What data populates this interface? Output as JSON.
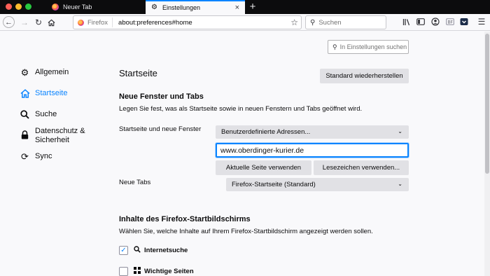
{
  "tabs": [
    {
      "title": "Neuer Tab",
      "favicon": "firefox-icon"
    },
    {
      "title": "Einstellungen",
      "favicon": "gear-icon",
      "active": true
    }
  ],
  "navbar": {
    "identity_label": "Firefox",
    "url": "about:preferences#home",
    "search_placeholder": "Suchen"
  },
  "sidebar": {
    "items": [
      {
        "label": "Allgemein",
        "icon": "gear-icon"
      },
      {
        "label": "Startseite",
        "icon": "home-icon",
        "active": true
      },
      {
        "label": "Suche",
        "icon": "search-icon"
      },
      {
        "label": "Datenschutz &",
        "label2": "Sicherheit",
        "icon": "lock-icon"
      },
      {
        "label": "Sync",
        "icon": "sync-icon"
      }
    ]
  },
  "prefs_search_placeholder": "In Einstellungen suchen",
  "main": {
    "title": "Startseite",
    "restore_button": "Standard wiederherstellen",
    "section1": {
      "title": "Neue Fenster und Tabs",
      "description": "Legen Sie fest, was als Startseite sowie in neuen Fenstern und Tabs geöffnet wird.",
      "homepage_label": "Startseite und neue Fenster",
      "homepage_select": "Benutzerdefinierte Adressen...",
      "homepage_url": "www.oberdinger-kurier.de",
      "use_current_button": "Aktuelle Seite verwenden",
      "use_bookmark_button": "Lesezeichen verwenden...",
      "newtabs_label": "Neue Tabs",
      "newtabs_select": "Firefox-Startseite (Standard)"
    },
    "section2": {
      "title": "Inhalte des Firefox-Startbildschirms",
      "description": "Wählen Sie, welche Inhalte auf Ihrem Firefox-Startbildschirm angezeigt werden sollen.",
      "options": [
        {
          "label": "Internetsuche",
          "checked": true,
          "icon": "search-icon"
        },
        {
          "label": "Wichtige Seiten",
          "checked": false,
          "icon": "grid-icon"
        }
      ]
    }
  },
  "colors": {
    "accent": "#0a84ff",
    "tabstrip": "#0c0c0d",
    "button": "#e1e1e5"
  }
}
